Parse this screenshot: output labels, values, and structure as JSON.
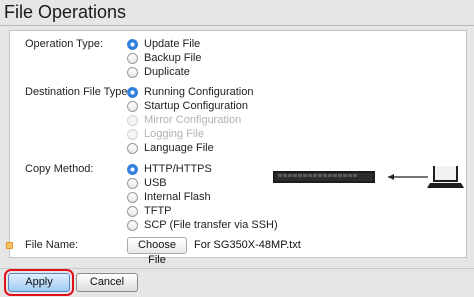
{
  "page": {
    "title": "File Operations"
  },
  "operation_type": {
    "label": "Operation Type:",
    "options": [
      {
        "label": "Update File",
        "selected": true
      },
      {
        "label": "Backup File",
        "selected": false
      },
      {
        "label": "Duplicate",
        "selected": false
      }
    ]
  },
  "destination_file_type": {
    "label": "Destination File Type:",
    "options": [
      {
        "label": "Running Configuration",
        "selected": true,
        "disabled": false
      },
      {
        "label": "Startup Configuration",
        "selected": false,
        "disabled": false
      },
      {
        "label": "Mirror Configuration",
        "selected": false,
        "disabled": true
      },
      {
        "label": "Logging File",
        "selected": false,
        "disabled": true
      },
      {
        "label": "Language File",
        "selected": false,
        "disabled": false
      }
    ]
  },
  "copy_method": {
    "label": "Copy Method:",
    "options": [
      {
        "label": "HTTP/HTTPS",
        "selected": true
      },
      {
        "label": "USB",
        "selected": false
      },
      {
        "label": "Internal Flash",
        "selected": false
      },
      {
        "label": "TFTP",
        "selected": false
      },
      {
        "label": "SCP (File transfer via SSH)",
        "selected": false
      }
    ]
  },
  "file_name": {
    "label": "File Name:",
    "button_label": "Choose File",
    "value": "For SG350X-48MP.txt"
  },
  "actions": {
    "apply_label": "Apply",
    "cancel_label": "Cancel"
  },
  "colors": {
    "accent": "#2f7fe0",
    "highlight": "#e0101a",
    "required": "#f7c266"
  },
  "icons": {
    "required": "required-field-icon",
    "switch": "network-switch-icon",
    "laptop": "laptop-icon",
    "arrow": "arrow-left-icon"
  }
}
